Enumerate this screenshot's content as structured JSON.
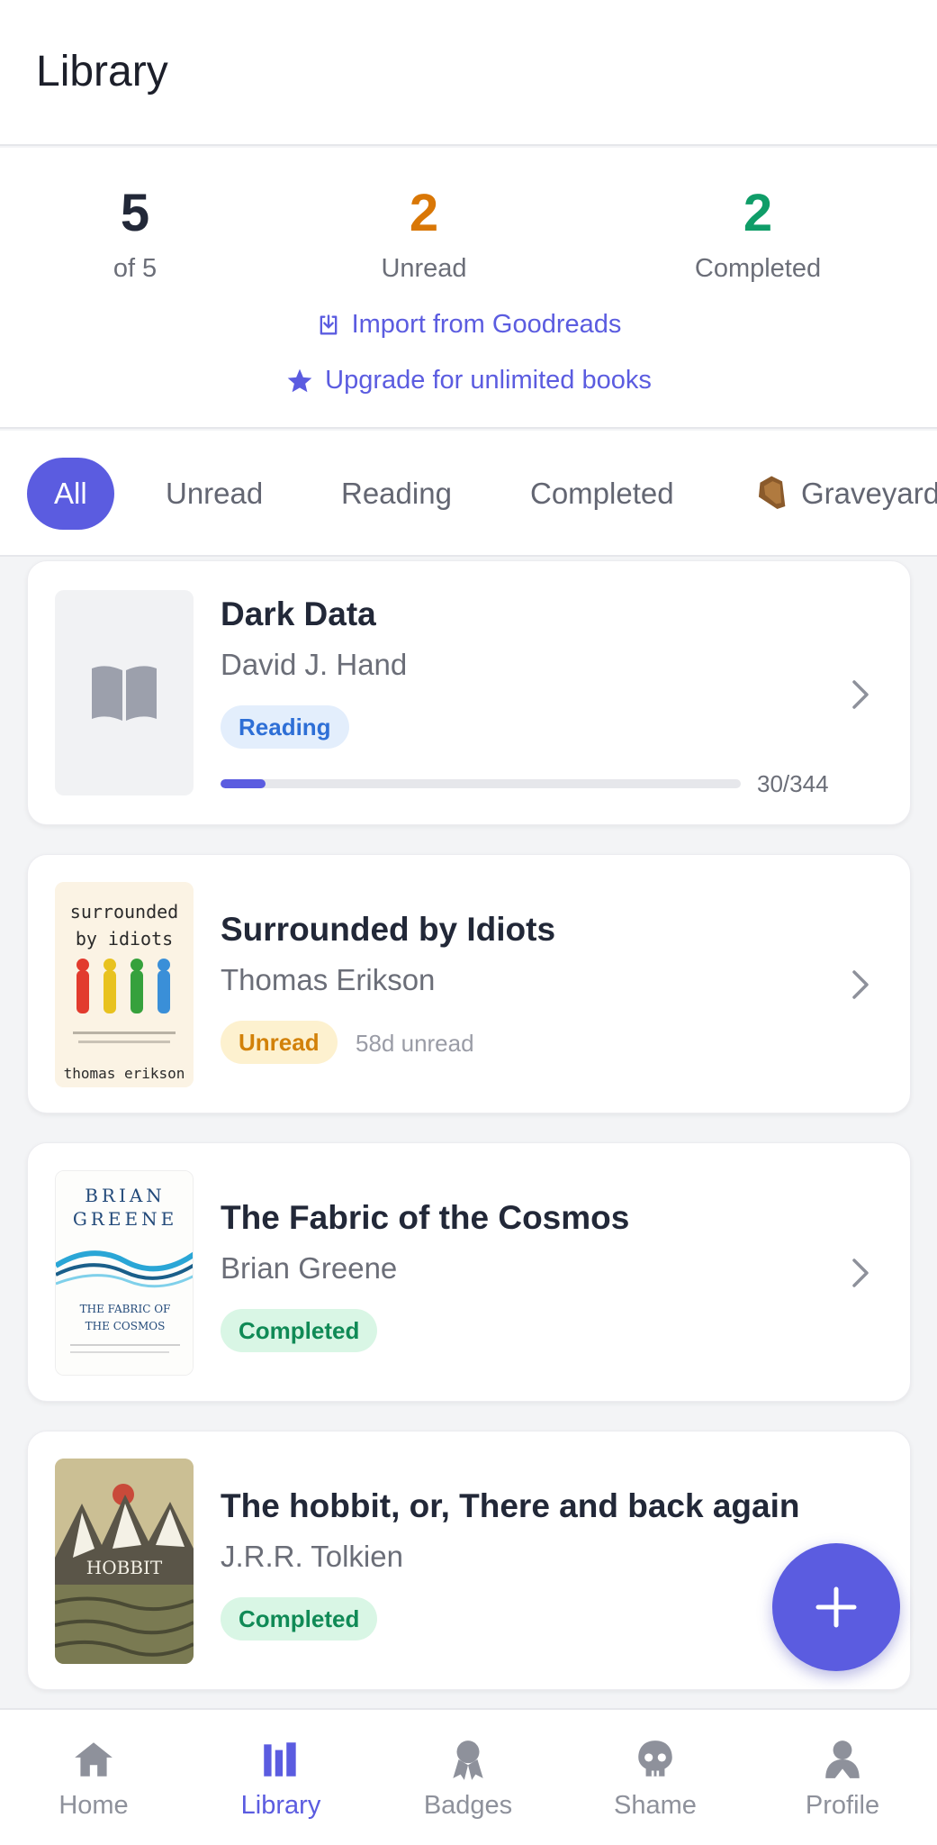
{
  "header": {
    "title": "Library"
  },
  "stats": {
    "total": {
      "value": "5",
      "label": "of 5"
    },
    "unread": {
      "value": "2",
      "label": "Unread"
    },
    "completed": {
      "value": "2",
      "label": "Completed"
    }
  },
  "actions": {
    "import_label": "Import from Goodreads",
    "upgrade_label": "Upgrade for unlimited books"
  },
  "filters": {
    "all": "All",
    "unread": "Unread",
    "reading": "Reading",
    "completed": "Completed",
    "graveyard": "Graveyard"
  },
  "books": [
    {
      "title": "Dark Data",
      "author": "David J. Hand",
      "status": "Reading",
      "progress_text": "30/344",
      "progress_fraction": 0.087,
      "cover_icon": "book-icon"
    },
    {
      "title": "Surrounded by Idiots",
      "author": "Thomas Erikson",
      "status": "Unread",
      "meta": "58d unread",
      "cover": {
        "line1": "surrounded",
        "line2": "by idiots",
        "author": "thomas erikson"
      }
    },
    {
      "title": "The Fabric of the Cosmos",
      "author": "Brian Greene",
      "status": "Completed",
      "cover": {
        "line1": "BRIAN",
        "line2": "GREENE",
        "line3": "THE FABRIC OF",
        "line4": "THE COSMOS"
      }
    },
    {
      "title": "The hobbit, or, There and back again",
      "author": "J.R.R. Tolkien",
      "status": "Completed",
      "cover": {
        "title": "HOBBIT"
      }
    }
  ],
  "nav": {
    "home": "Home",
    "library": "Library",
    "badges": "Badges",
    "shame": "Shame",
    "profile": "Profile"
  },
  "colors": {
    "accent": "#5b5ce0",
    "unread": "#d97706",
    "completed": "#0f9d68"
  }
}
